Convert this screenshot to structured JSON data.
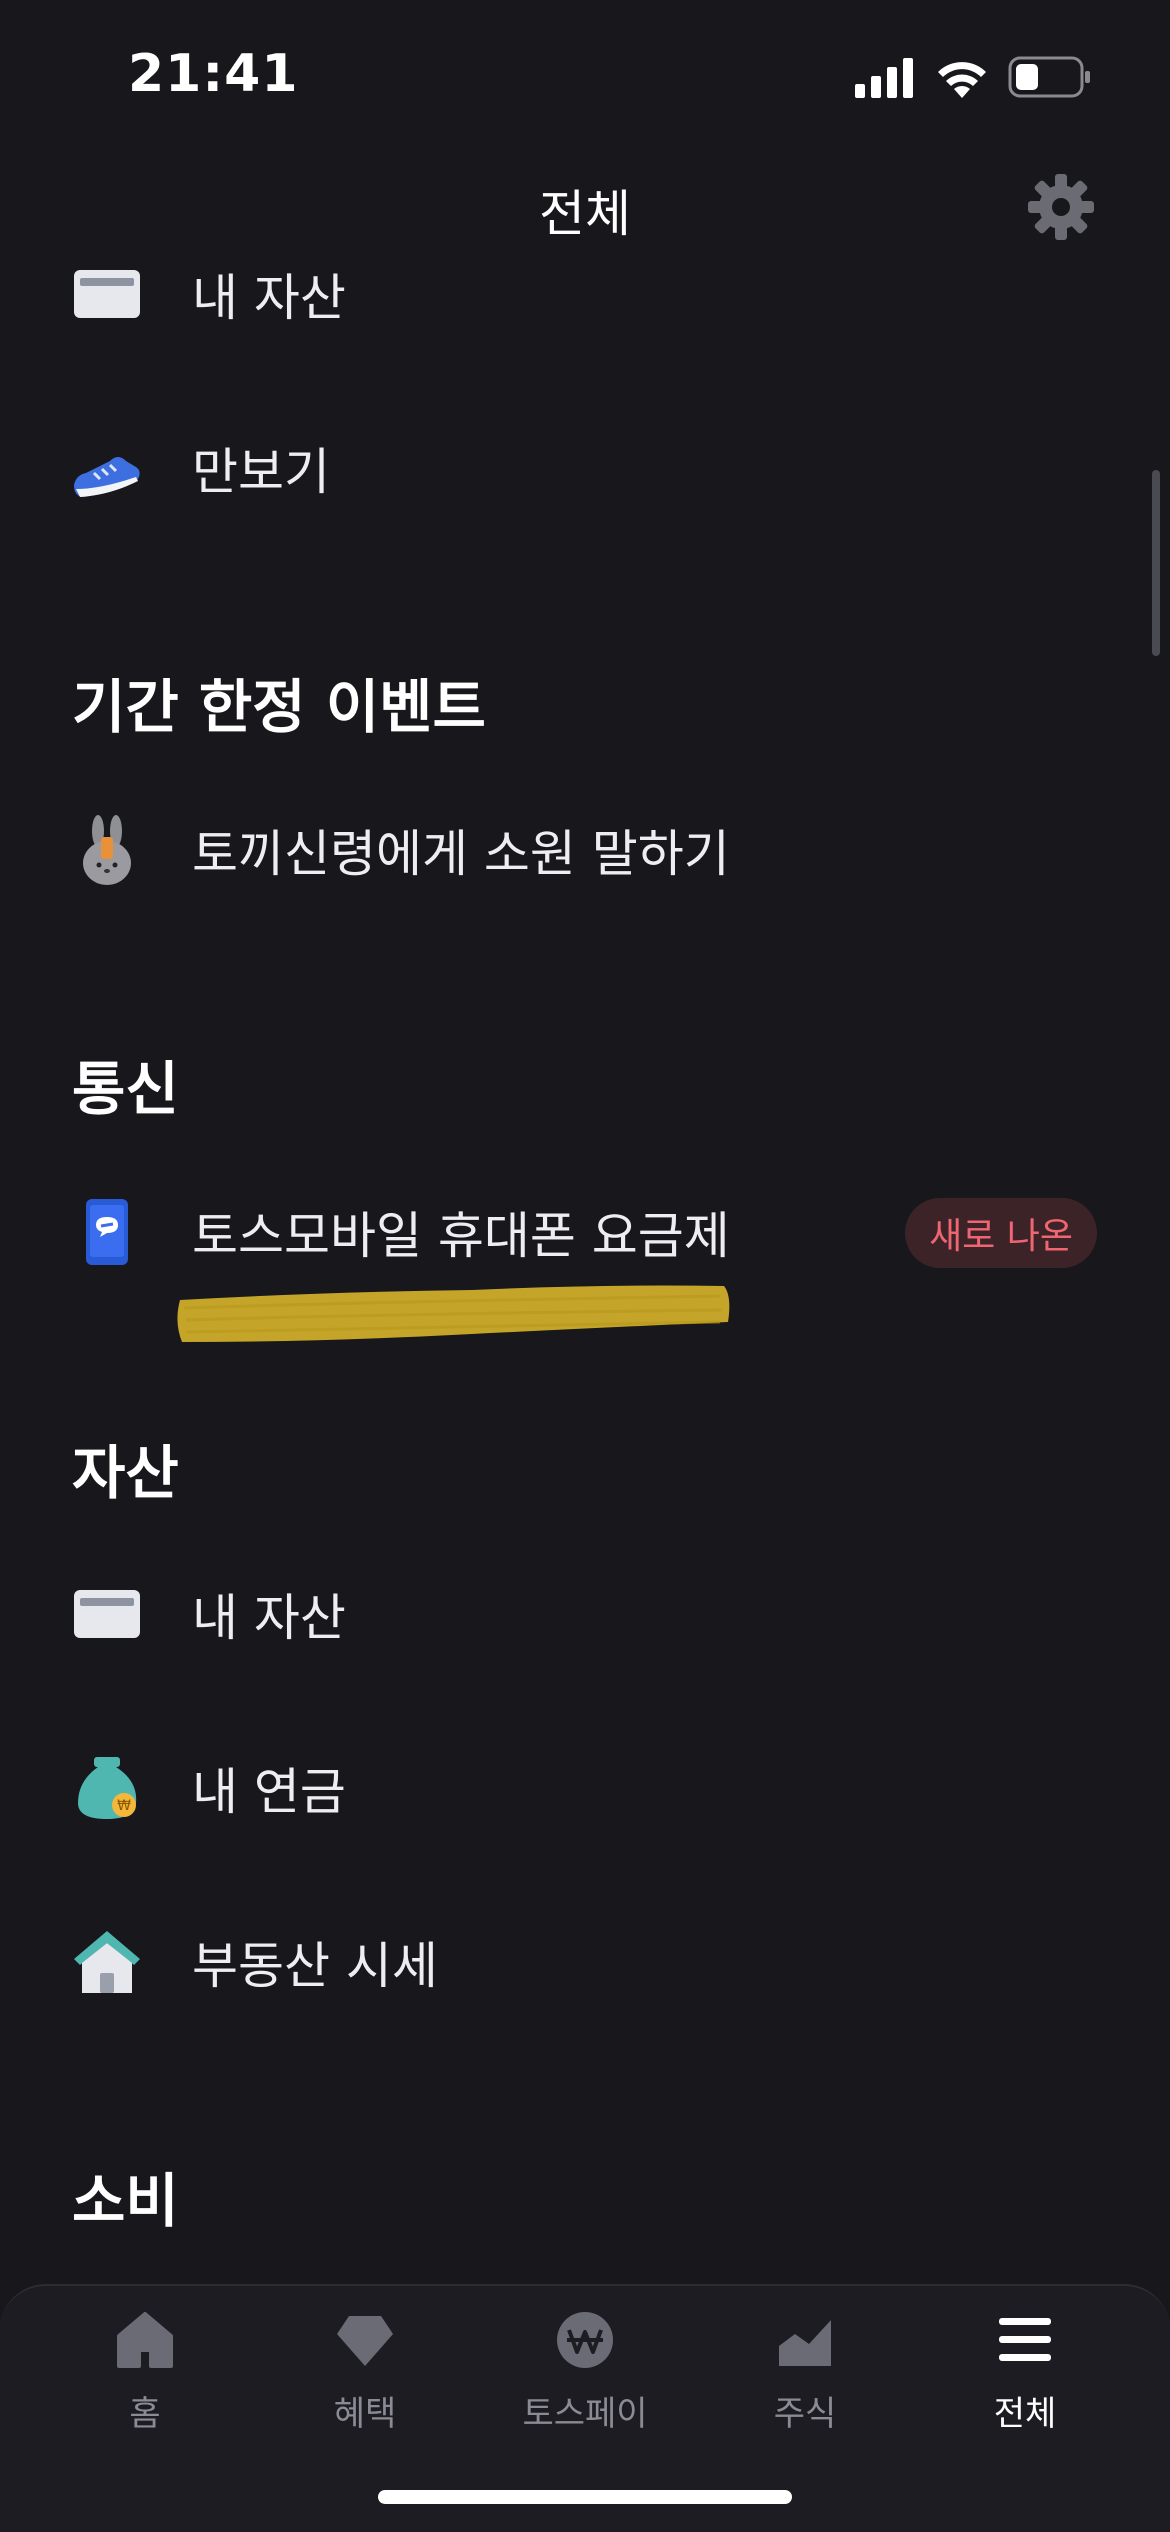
{
  "status_bar": {
    "time": "21:41"
  },
  "header": {
    "title": "전체"
  },
  "items_top": [
    {
      "label": "내 자산",
      "icon": "card-icon"
    },
    {
      "label": "만보기",
      "icon": "sneaker-icon"
    }
  ],
  "sections": {
    "event": {
      "title": "기간 한정 이벤트",
      "items": [
        {
          "label": "토끼신령에게 소원 말하기",
          "icon": "rabbit-icon"
        }
      ]
    },
    "telecom": {
      "title": "통신",
      "items": [
        {
          "label": "토스모바일 휴대폰 요금제",
          "icon": "phone-icon",
          "badge": "새로 나온"
        }
      ]
    },
    "assets": {
      "title": "자산",
      "items": [
        {
          "label": "내 자산",
          "icon": "card-icon"
        },
        {
          "label": "내 연금",
          "icon": "money-bag-icon"
        },
        {
          "label": "부동산 시세",
          "icon": "house-icon"
        }
      ]
    },
    "spending": {
      "title": "소비"
    }
  },
  "tabbar": {
    "tabs": [
      {
        "label": "홈",
        "icon": "home-icon"
      },
      {
        "label": "혜택",
        "icon": "gem-icon"
      },
      {
        "label": "토스페이",
        "icon": "won-icon"
      },
      {
        "label": "주식",
        "icon": "stock-chart-icon"
      },
      {
        "label": "전체",
        "icon": "menu-icon",
        "active": true
      }
    ]
  },
  "colors": {
    "background": "#17171c",
    "badge_bg": "#3b2327",
    "badge_text": "#f06572",
    "highlight": "#d4b22a"
  }
}
